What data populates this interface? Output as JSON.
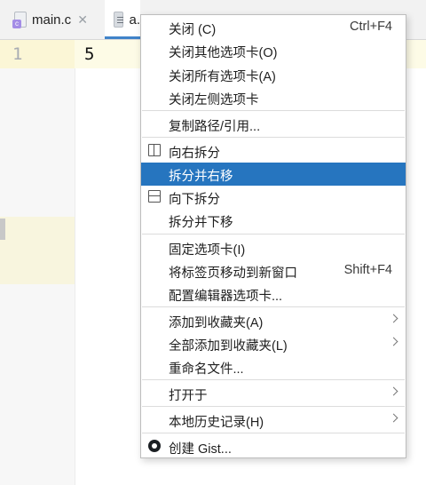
{
  "tabs": [
    {
      "label": "main.c",
      "close": "✕"
    },
    {
      "label": "a."
    }
  ],
  "editor": {
    "line_number": "1",
    "code": "5"
  },
  "menu": {
    "items": [
      {
        "label": "关闭 (C)",
        "shortcut": "Ctrl+F4"
      },
      {
        "label": "关闭其他选项卡(O)"
      },
      {
        "label": "关闭所有选项卡(A)"
      },
      {
        "label": "关闭左侧选项卡"
      },
      {
        "label": "复制路径/引用..."
      },
      {
        "label": "向右拆分",
        "icon": "split-vertical-icon"
      },
      {
        "label": "拆分并右移",
        "selected": true
      },
      {
        "label": "向下拆分",
        "icon": "split-horizontal-icon"
      },
      {
        "label": "拆分并下移"
      },
      {
        "label": "固定选项卡(I)"
      },
      {
        "label": "将标签页移动到新窗口",
        "shortcut": "Shift+F4"
      },
      {
        "label": "配置编辑器选项卡..."
      },
      {
        "label": "添加到收藏夹(A)",
        "submenu": true
      },
      {
        "label": "全部添加到收藏夹(L)",
        "submenu": true
      },
      {
        "label": "重命名文件..."
      },
      {
        "label": "打开于",
        "submenu": true
      },
      {
        "label": "本地历史记录(H)",
        "submenu": true
      },
      {
        "label": "创建 Gist...",
        "icon": "github-icon"
      }
    ]
  },
  "colors": {
    "selection": "#2675bf",
    "active_tab_underline": "#4083c9"
  }
}
